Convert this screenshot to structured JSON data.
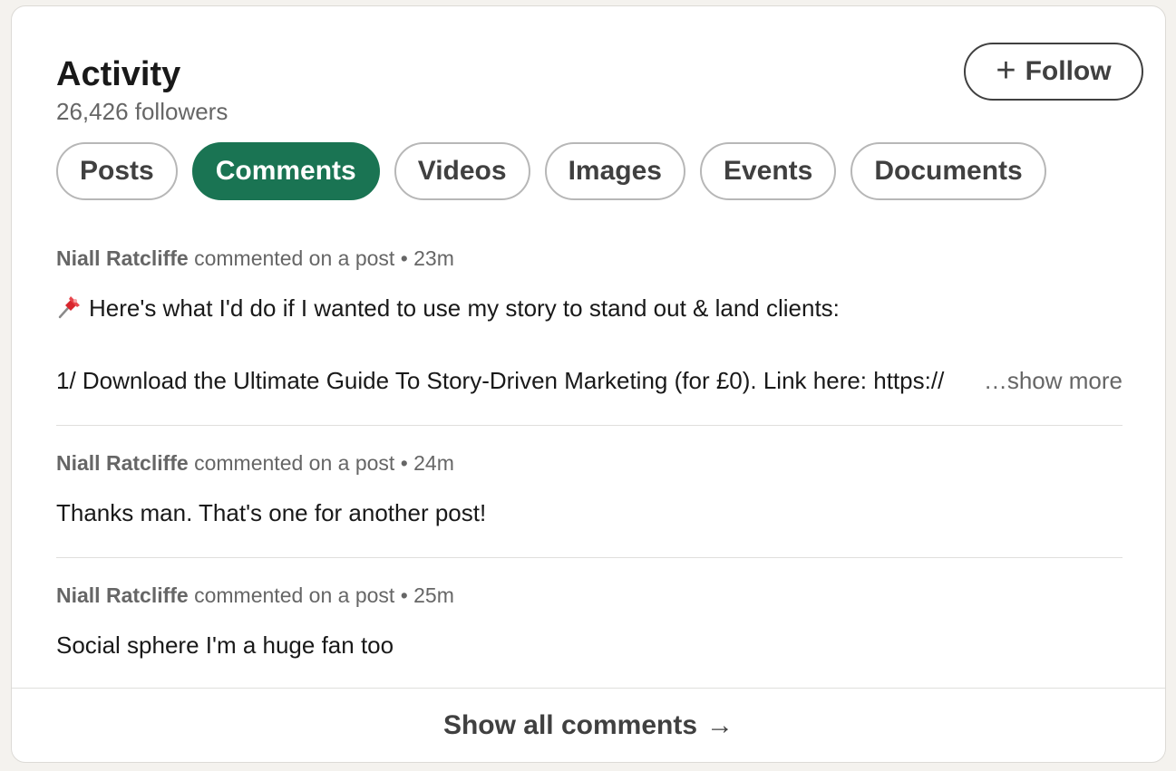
{
  "header": {
    "title": "Activity",
    "followers": "26,426 followers",
    "follow_label": "Follow"
  },
  "tabs": [
    {
      "label": "Posts",
      "active": false
    },
    {
      "label": "Comments",
      "active": true
    },
    {
      "label": "Videos",
      "active": false
    },
    {
      "label": "Images",
      "active": false
    },
    {
      "label": "Events",
      "active": false
    },
    {
      "label": "Documents",
      "active": false
    }
  ],
  "comments": [
    {
      "author": "Niall Ratcliffe",
      "action": "commented on a post",
      "time": "23m",
      "line1": "Here's what I'd do if I wanted to use my story to stand out & land clients:",
      "line2": "1/ Download the Ultimate Guide To Story-Driven Marketing (for £0). Link here: https://",
      "show_more": "…show more"
    },
    {
      "author": "Niall Ratcliffe",
      "action": "commented on a post",
      "time": "24m",
      "text": "Thanks man. That's one for another post!"
    },
    {
      "author": "Niall Ratcliffe",
      "action": "commented on a post",
      "time": "25m",
      "text": "Social sphere I'm a huge fan too"
    }
  ],
  "footer": {
    "label": "Show all comments"
  },
  "colors": {
    "accent": "#1a7453",
    "background": "#f4f2ee"
  },
  "icons": {
    "follow": "plus-icon",
    "pin": "pushpin-icon",
    "footer": "arrow-right-icon"
  }
}
